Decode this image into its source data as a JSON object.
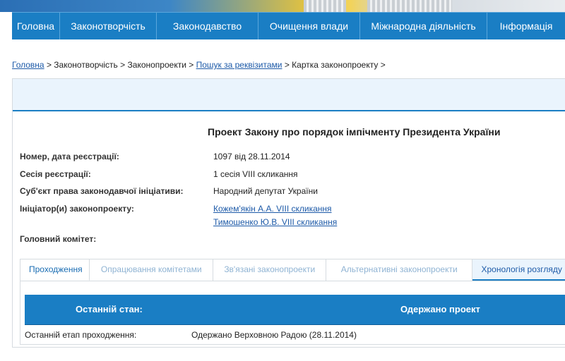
{
  "nav": {
    "items": [
      "Головна",
      "Законотворчість",
      "Законодавство",
      "Очищення влади",
      "Міжнародна діяльність",
      "Інформація"
    ]
  },
  "breadcrumb": {
    "home": "Головна",
    "sep": ">",
    "lawmaking": "Законотворчість",
    "bills": "Законопроекти",
    "search": "Пошук за реквізитами",
    "card": "Картка законопроекту"
  },
  "bill": {
    "title": "Проект Закону про порядок імпічменту Президента України",
    "fields": [
      {
        "label": "Номер, дата реєстрації:",
        "value": "1097 від 28.11.2014"
      },
      {
        "label": "Сесія реєстрації:",
        "value": "1 сесія VIII скликання"
      },
      {
        "label": "Суб'єкт права законодавчої ініціативи:",
        "value": "Народний депутат України"
      }
    ],
    "initiators_label": "Ініціатор(и) законопроекту:",
    "initiators": [
      "Кожем'якін А.А. VIII скликання",
      "Тимошенко Ю.В. VIII скликання"
    ],
    "committee_label": "Головний комітет:"
  },
  "tabs": [
    "Проходження",
    "Опрацювання комітетами",
    "Зв'язані законопроекти",
    "Альтернативні законопроекти",
    "Хронологія розгляду"
  ],
  "status": {
    "last_state_label": "Останній стан:",
    "last_state_value": "Одержано проект",
    "stage_label": "Останній етап проходження:",
    "stage_value": "Одержано Верховною Радою (28.11.2014)"
  },
  "colors": {
    "accent": "#1a7ec4",
    "link": "#1d5aa8",
    "tab_inactive": "#8fb3d3"
  }
}
